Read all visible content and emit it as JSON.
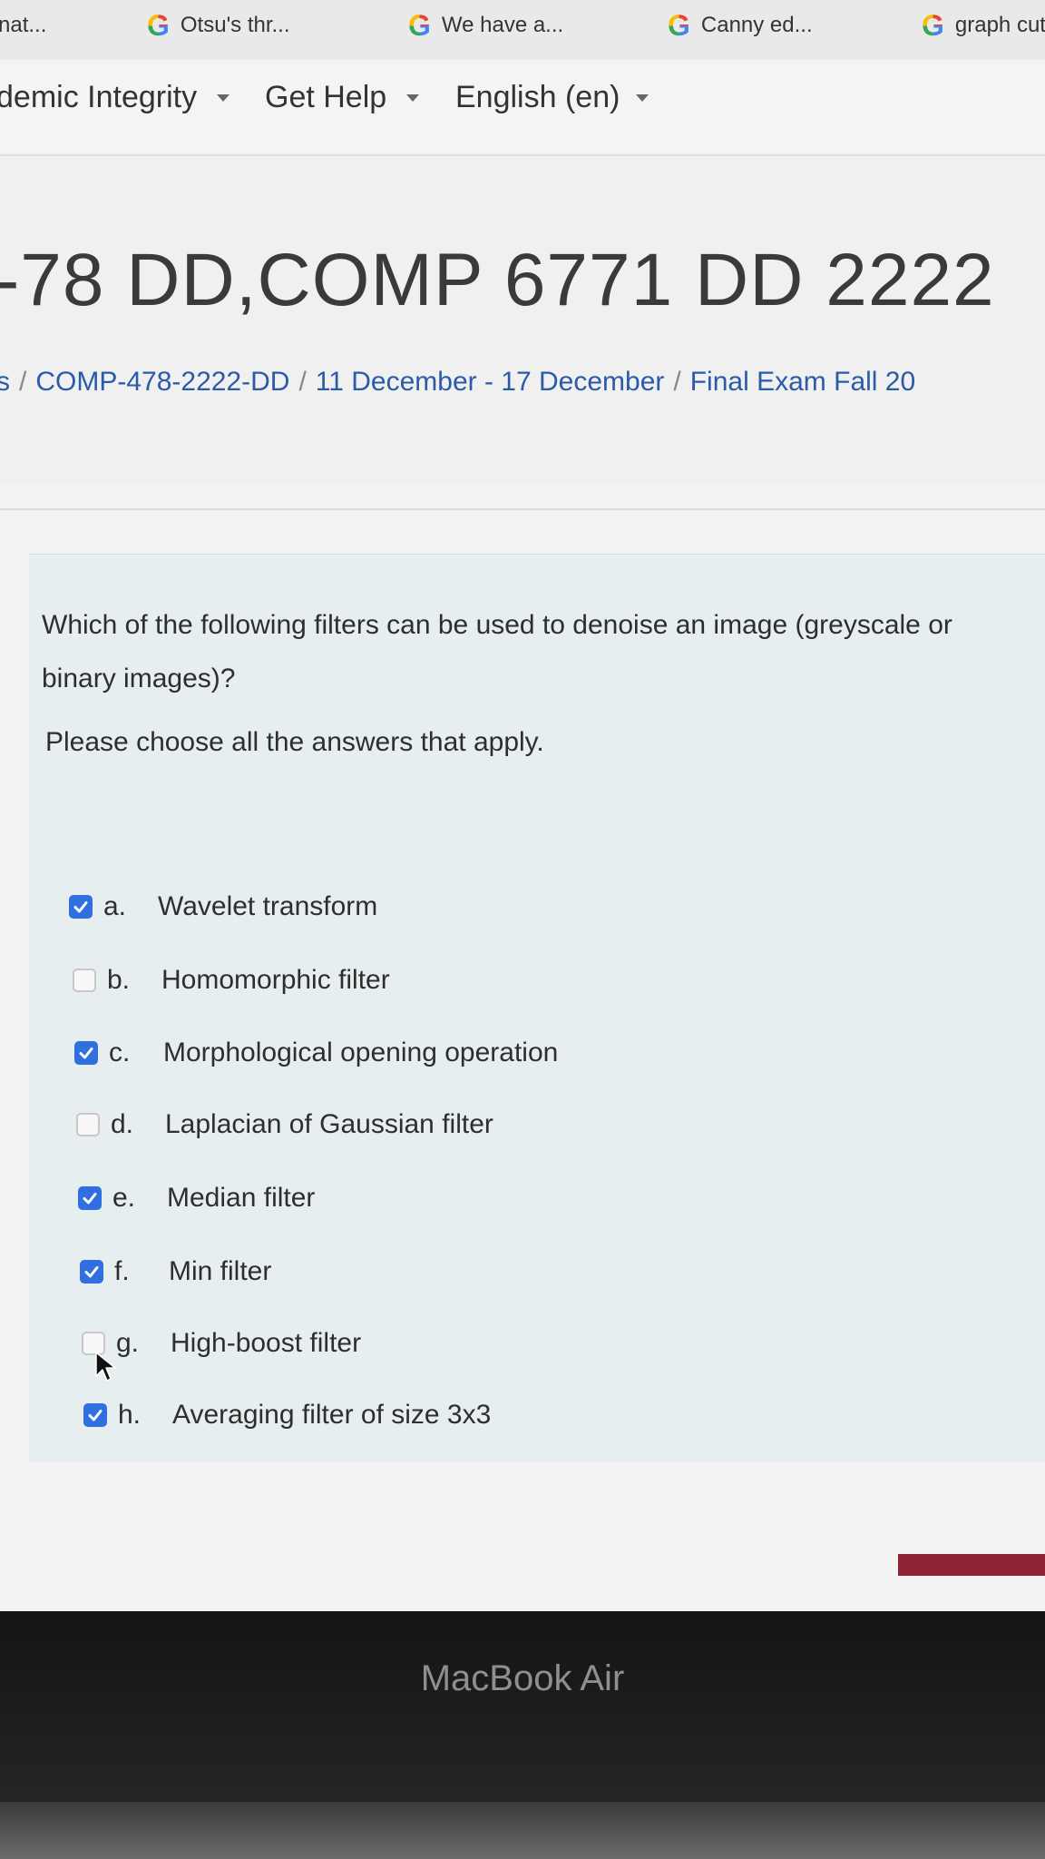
{
  "bookmarks": [
    {
      "label": "nat...",
      "icon": "none"
    },
    {
      "label": "Otsu's thr...",
      "icon": "google-icon"
    },
    {
      "label": "We have a...",
      "icon": "google-icon"
    },
    {
      "label": "Canny ed...",
      "icon": "google-icon"
    },
    {
      "label": "graph cut",
      "icon": "google-icon"
    }
  ],
  "google_letter": "G",
  "nav": {
    "academic_integrity": "demic Integrity",
    "get_help": "Get Help",
    "language": "English (en)"
  },
  "page": {
    "title": "-78 DD,COMP 6771 DD 2222",
    "breadcrumb": [
      "s",
      "COMP-478-2222-DD",
      "11 December - 17 December",
      "Final Exam Fall 20"
    ],
    "breadcrumb_sep": "/"
  },
  "question": {
    "text": "Which of the following filters can be used to denoise an image (greyscale or binary images)?",
    "hint": "Please choose all the answers that apply.",
    "options": [
      {
        "letter": "a.",
        "label": "Wavelet transform",
        "checked": true
      },
      {
        "letter": "b.",
        "label": "Homomorphic filter",
        "checked": false
      },
      {
        "letter": "c.",
        "label": "Morphological opening operation",
        "checked": true
      },
      {
        "letter": "d.",
        "label": "Laplacian of Gaussian filter",
        "checked": false
      },
      {
        "letter": "e.",
        "label": "Median filter",
        "checked": true
      },
      {
        "letter": "f.",
        "label": "Min filter",
        "checked": true
      },
      {
        "letter": "g.",
        "label": "High-boost filter",
        "checked": false
      },
      {
        "letter": "h.",
        "label": "Averaging filter of size 3x3",
        "checked": true
      }
    ]
  },
  "device": {
    "brand": "MacBook Air"
  },
  "colors": {
    "checkbox_checked": "#2f6fe0",
    "link": "#2a5aa8",
    "accent_tab": "#8c2233"
  }
}
